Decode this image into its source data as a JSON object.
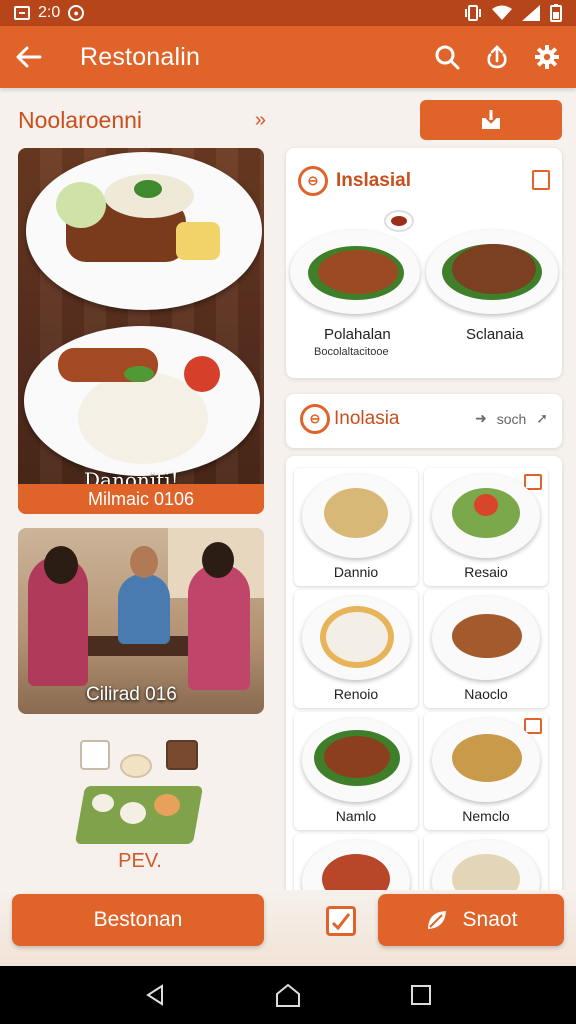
{
  "status_bar": {
    "time": "2:0"
  },
  "app_bar": {
    "title": "Restonalin"
  },
  "left": {
    "section_title": "Noolaroenni",
    "hero_caption": "Milmaic 0106",
    "hero_overlay": "Danoniti!",
    "photo_caption": "Cilirad 016",
    "logo_text": "PEV."
  },
  "card_featured": {
    "title": "Inslasial",
    "items": [
      {
        "label": "Polahalan",
        "sublabel": "Bocolaltacitooe"
      },
      {
        "label": "Sclanaia",
        "sublabel": ""
      }
    ]
  },
  "card_category": {
    "title": "Inolasia",
    "meta": "soch"
  },
  "grid_items": [
    {
      "label": "Dannio"
    },
    {
      "label": "Resaio"
    },
    {
      "label": "Renoio"
    },
    {
      "label": "Naoclo"
    },
    {
      "label": "Namlo"
    },
    {
      "label": "Nemclo"
    }
  ],
  "bottom": {
    "left_button": "Bestonan",
    "right_button": "Snaot"
  },
  "colors": {
    "accent": "#e0642a",
    "status_bar": "#b6451a",
    "title_text": "#c94f1c"
  }
}
